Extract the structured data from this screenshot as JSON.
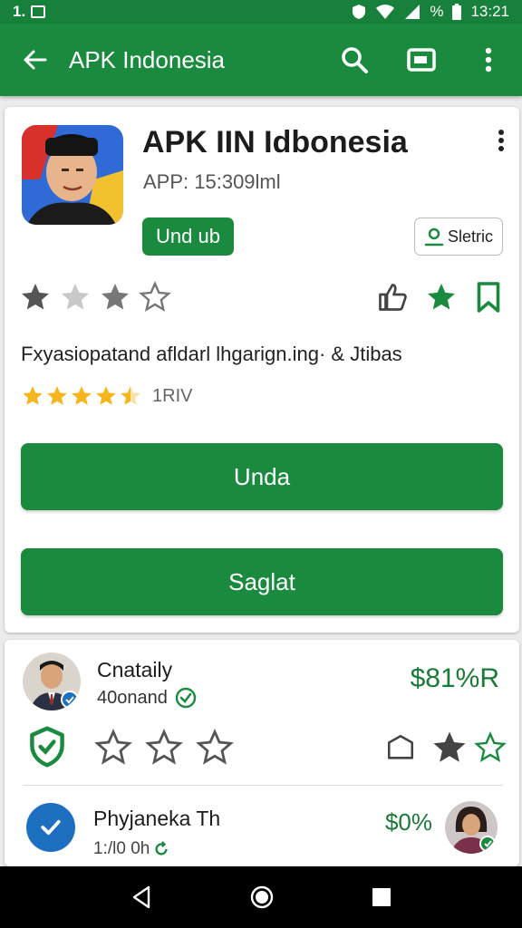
{
  "status_bar": {
    "time_left": "1.",
    "battery_text": "%",
    "clock": "13:21"
  },
  "app_bar": {
    "title": "APK Indonesia"
  },
  "app": {
    "name": "APK IIN Idbonesia",
    "subtitle": "APP: 15:309lml",
    "chip_primary": "Und ub",
    "chip_secondary": "Sletric",
    "description": "Fxyasiopatand afldarl lhgarign.ing· & Jtibas",
    "rating_count": "1RIV",
    "rating_value": 4.5,
    "primary_button": "Unda",
    "secondary_button": "Saglat"
  },
  "reviews": [
    {
      "name": "Cnataily",
      "meta": "40onand",
      "price": "$81%R"
    },
    {
      "name": "Phyjaneka Th",
      "meta": "1:/l0 0h",
      "price": "$0%"
    }
  ],
  "colors": {
    "primary_green": "#1a8a3e",
    "dark_green": "#17803a",
    "accent_star_gold": "#f5b51c",
    "verified_blue": "#1d6fbf"
  }
}
